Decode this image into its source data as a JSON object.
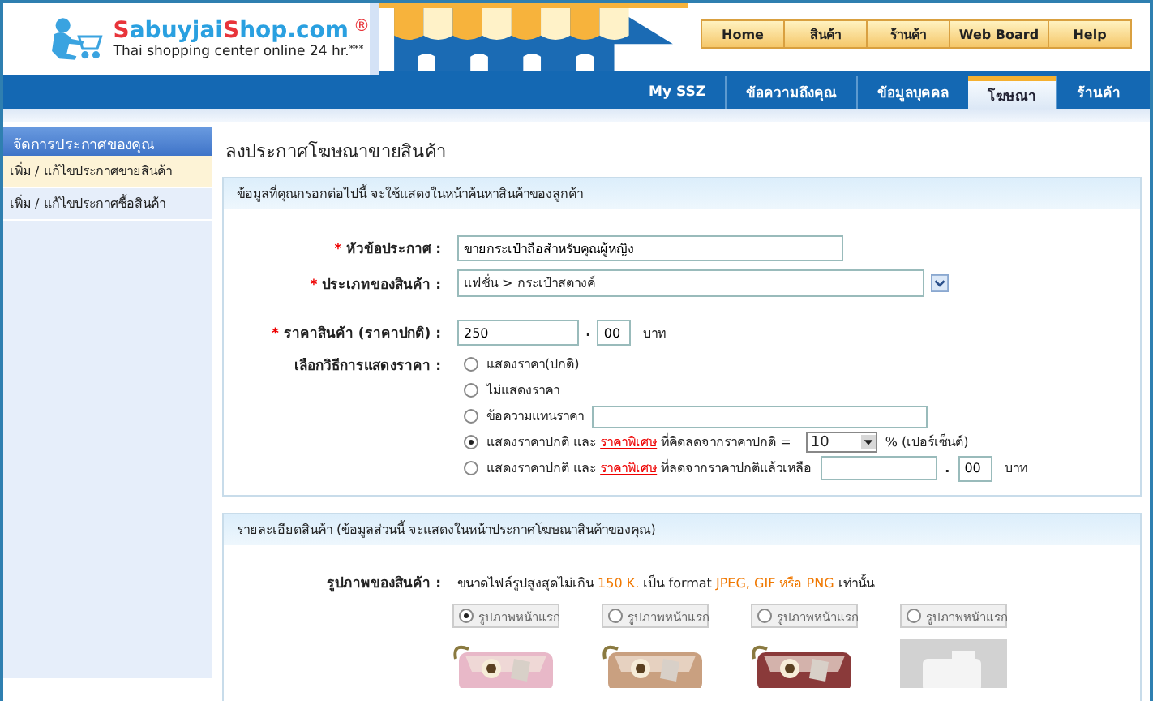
{
  "logo": {
    "segments": [
      {
        "text": "S",
        "accent": true
      },
      {
        "text": "abuyjai",
        "accent": false
      },
      {
        "text": "S",
        "accent": true
      },
      {
        "text": "hop.com",
        "accent": false
      }
    ],
    "mark": "®",
    "tagline": "Thai shopping center online 24 hr.",
    "tagline_mark": "***"
  },
  "top_nav": [
    "Home",
    "สินค้า",
    "ร้านค้า",
    "Web Board",
    "Help"
  ],
  "sub_tabs": [
    {
      "label": "My SSZ",
      "selected": false
    },
    {
      "label": "ข้อความถึงคุณ",
      "selected": false
    },
    {
      "label": "ข้อมูลบุคคล",
      "selected": false
    },
    {
      "label": "โฆษณา",
      "selected": true
    },
    {
      "label": "ร้านค้า",
      "selected": false
    }
  ],
  "sidebar": {
    "title": "จัดการประกาศของคุณ",
    "items": [
      {
        "label": "เพิ่ม / แก้ไขประกาศขายสินค้า",
        "selected": true
      },
      {
        "label": "เพิ่ม / แก้ไขประกาศซื้อสินค้า",
        "selected": false
      }
    ]
  },
  "page_title": "ลงประกาศโฆษณาขายสินค้า",
  "section1": {
    "header": "ข้อมูลที่คุณกรอกต่อไปนี้ จะใช้แสดงในหน้าค้นหาสินค้าของลูกค้า",
    "title_field": {
      "label": "หัวข้อประกาศ :",
      "required_mark": "*",
      "value": "ขายกระเป๋าถือสำหรับคุณผู้หญิง"
    },
    "type_field": {
      "label": "ประเภทของสินค้า :",
      "required_mark": "*",
      "value": "แฟชั่น > กระเป๋าสตางค์"
    },
    "price_field": {
      "label": "ราคาสินค้า (ราคาปกติ) :",
      "required_mark": "*",
      "value": "250",
      "separator": ".",
      "decimals": "00",
      "unit": "บาท"
    },
    "price_display": {
      "label": "เลือกวิธีการแสดงราคา :",
      "options": [
        {
          "kind": "plain",
          "selected": false,
          "text": "แสดงราคา(ปกติ)"
        },
        {
          "kind": "plain",
          "selected": false,
          "text": "ไม่แสดงราคา"
        },
        {
          "kind": "text_input",
          "selected": false,
          "text": "ข้อความแทนราคา"
        },
        {
          "kind": "percent",
          "selected": true,
          "before": "แสดงราคาปกติ และ",
          "link": "ราคาพิเศษ",
          "after": "ที่คิดลดจากราคาปกติ =",
          "value": "10",
          "suffix": "% (เปอร์เซ็นต์)"
        },
        {
          "kind": "amount",
          "selected": false,
          "before": "แสดงราคาปกติ และ",
          "link": "ราคาพิเศษ",
          "after": "ที่ลดจากราคาปกติแล้วเหลือ",
          "separator": ".",
          "decimals": "00",
          "unit": "บาท"
        }
      ]
    }
  },
  "section2": {
    "header": "รายละเอียดสินค้า (ข้อมูลส่วนนี้ จะแสดงในหน้าประกาศโฆษณาสินค้าของคุณ)",
    "images_label": "รูปภาพของสินค้า :",
    "images_note_parts": [
      {
        "text": "ขนาดไฟล์รูปสูงสุดไม่เกิน",
        "highlight": false
      },
      {
        "text": "150 K.",
        "highlight": true
      },
      {
        "text": "เป็น format",
        "highlight": false
      },
      {
        "text": "JPEG, GIF หรือ PNG",
        "highlight": true
      },
      {
        "text": "เท่านั้น",
        "highlight": false
      }
    ],
    "images": [
      {
        "label": "รูปภาพหน้าแรก",
        "selected": true,
        "kind": "picture"
      },
      {
        "label": "รูปภาพหน้าแรก",
        "selected": false,
        "kind": "picture"
      },
      {
        "label": "รูปภาพหน้าแรก",
        "selected": false,
        "kind": "picture"
      },
      {
        "label": "รูปภาพหน้าแรก",
        "selected": false,
        "kind": "empty"
      }
    ]
  }
}
